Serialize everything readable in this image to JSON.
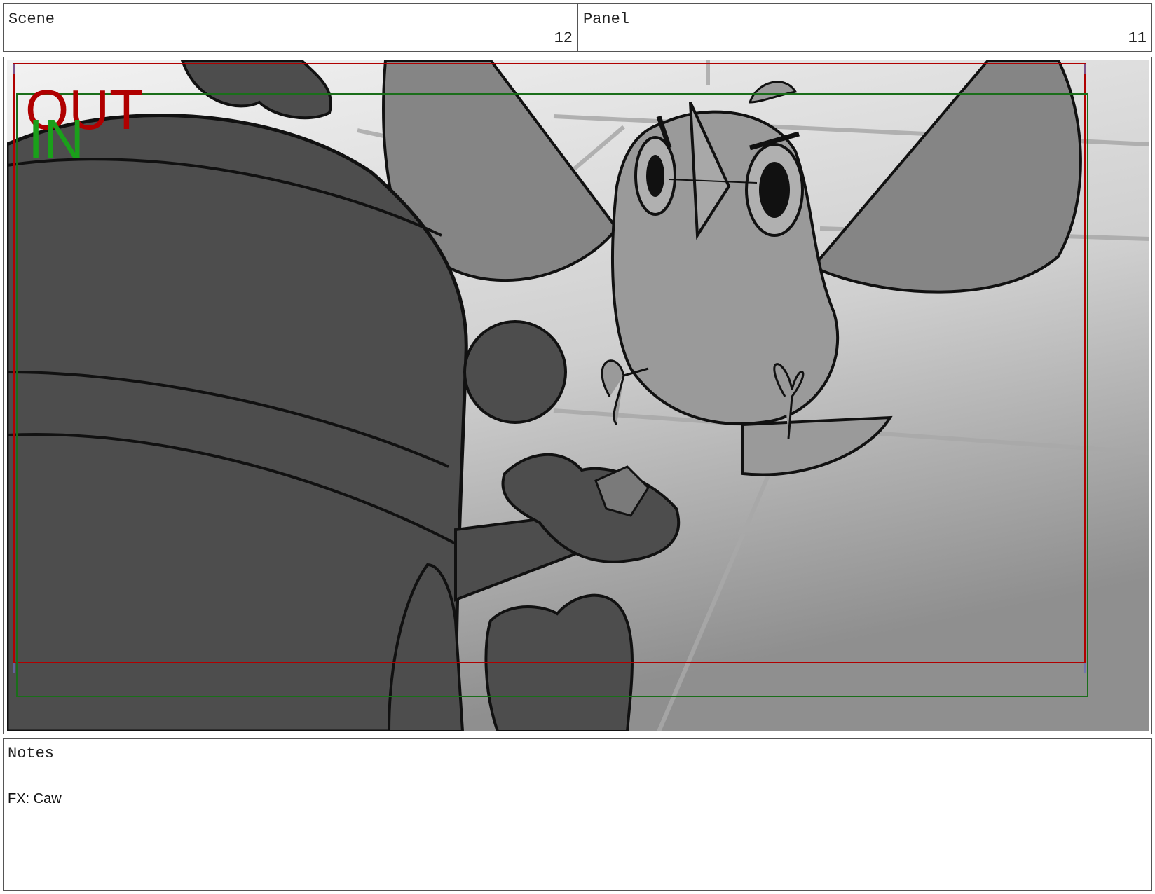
{
  "header": {
    "scene_label": "Scene",
    "scene_number": "12",
    "panel_label": "Panel",
    "panel_number": "11"
  },
  "frame": {
    "out_marker": "OUT",
    "in_marker": "IN",
    "out_color": "#b00000",
    "in_color": "#1aa01a"
  },
  "notes": {
    "label": "Notes",
    "text": "FX: Caw"
  }
}
